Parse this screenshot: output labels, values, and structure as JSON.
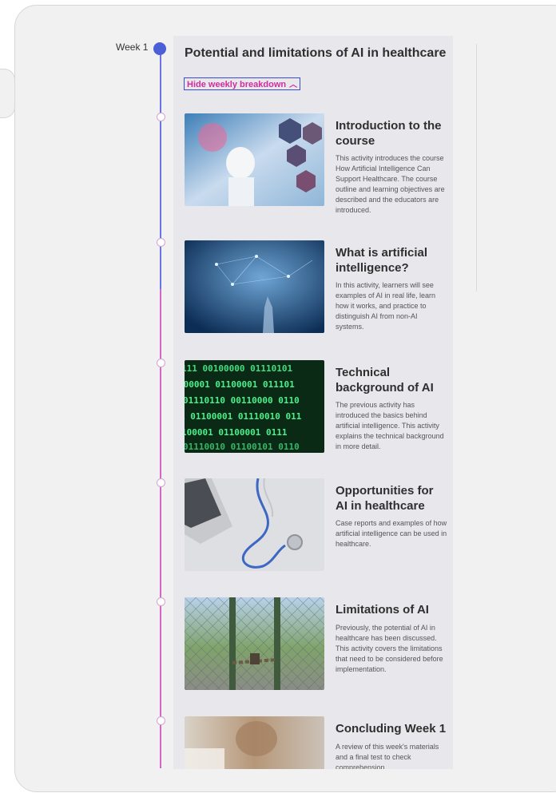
{
  "week": {
    "label": "Week 1"
  },
  "panel": {
    "title": "Potential and limitations of AI in healthcare",
    "toggle_label": "Hide weekly breakdown",
    "toggle_icon": "chevron-up-icon"
  },
  "activities": [
    {
      "title": "Introduction to the course",
      "description": "This activity introduces the course How Artificial Intelligence Can Support Healthcare. The course outline and learning objectives are described and the educators are introduced."
    },
    {
      "title": "What is artificial intelligence?",
      "description": "In this activity, learners will see examples of AI in real life, learn how it works, and practice to distinguish AI from non-AI systems."
    },
    {
      "title": "Technical background of AI",
      "description": "The previous activity has introduced the basics behind artificial intelligence. This activity explains the technical background in more detail."
    },
    {
      "title": "Opportunities for AI in healthcare",
      "description": "Case reports and examples of how artificial intelligence can be used in healthcare."
    },
    {
      "title": "Limitations of AI",
      "description": "Previously, the potential of AI in healthcare has been discussed. This activity covers the limitations that need to be considered before implementation."
    },
    {
      "title": "Concluding Week 1",
      "description": "A review of this week's materials and a final test to check comprehension."
    }
  ],
  "colors": {
    "week_dot": "#4b5fd6",
    "line_top": "#6a74e8",
    "line_bottom": "#d466c8",
    "toggle_text": "#d22ba0",
    "toggle_border": "#3a4bd0"
  }
}
